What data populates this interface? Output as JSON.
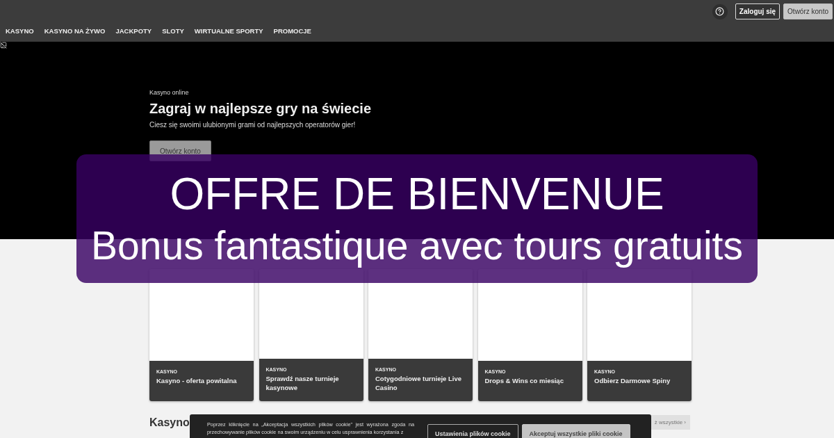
{
  "header": {
    "buttons": [
      {
        "kind": "outline",
        "label": "Zaloguj się"
      },
      {
        "kind": "filled",
        "label": "Otwórz konto"
      }
    ]
  },
  "nav": {
    "items": [
      "KASYNO",
      "KASYNO NA ŻYWO",
      "JACKPOTY",
      "SLOTY",
      "WIRTUALNE SPORTY",
      "PROMOCJE"
    ]
  },
  "hero": {
    "eyebrow": "Kasyno online",
    "title": "Zagraj w najlepsze gry na świecie",
    "subtitle": "Ciesz się swoimi ulubionymi grami od najlepszych operatorów gier!",
    "button": "Otwórz konto"
  },
  "promotions": {
    "cards": [
      {
        "category": "KASYNO",
        "title": "Kasyno - oferta powitalna"
      },
      {
        "category": "KASYNO",
        "title": "Sprawdź nasze turnieje kasynowe"
      },
      {
        "category": "KASYNO",
        "title": "Cotygodniowe turnieje Live Casino"
      },
      {
        "category": "KASYNO",
        "title": "Drops & Wins co miesiąc"
      },
      {
        "category": "KASYNO",
        "title": "Odbierz Darmowe Spiny"
      }
    ]
  },
  "casino_section": {
    "heading": "Kasyno",
    "link": "ż wszystkie ›"
  },
  "cookie_banner": {
    "text": "Poprzez kliknięcie na „Akceptacja wszystkich plików cookie\" jest wyrażona zgoda na przechowywanie plików cookie na swoim urządzeniu w celu usprawnienia korzystania z",
    "buttons": [
      {
        "kind": "outline",
        "label": "Ustawienia plików cookie"
      },
      {
        "kind": "filled",
        "label": "Akceptuj wszystkie pliki cookie"
      }
    ]
  },
  "offer_overlay": {
    "title": "OFFRE DE BIENVENUE",
    "subtitle": "Bonus fantastique avec tours gratuits"
  }
}
